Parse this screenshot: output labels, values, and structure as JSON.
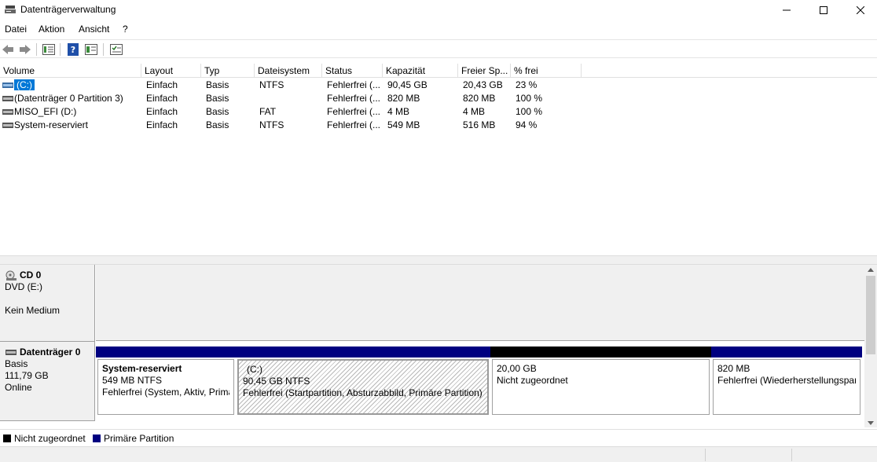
{
  "window": {
    "title": "Datenträgerverwaltung"
  },
  "menu": [
    {
      "id": "file",
      "label": "Datei"
    },
    {
      "id": "action",
      "label": "Aktion"
    },
    {
      "id": "view",
      "label": "Ansicht"
    },
    {
      "id": "help",
      "label": "?"
    }
  ],
  "toolbar": {
    "icons": [
      "back-arrow-icon",
      "forward-arrow-icon",
      "properties-icon",
      "help-icon",
      "console-tree-icon",
      "rescan-icon"
    ]
  },
  "volume_list": {
    "columns": [
      "Volume",
      "Layout",
      "Typ",
      "Dateisystem",
      "Status",
      "Kapazität",
      "Freier Sp...",
      "% frei"
    ],
    "rows": [
      {
        "volume": "(C:)",
        "layout": "Einfach",
        "type": "Basis",
        "fs": "NTFS",
        "status": "Fehlerfrei (...",
        "capacity": "90,45 GB",
        "free": "20,43 GB",
        "pct": "23 %",
        "selected": true
      },
      {
        "volume": "(Datenträger 0 Partition 3)",
        "layout": "Einfach",
        "type": "Basis",
        "fs": "",
        "status": "Fehlerfrei (...",
        "capacity": "820 MB",
        "free": "820 MB",
        "pct": "100 %",
        "selected": false
      },
      {
        "volume": "MISO_EFI (D:)",
        "layout": "Einfach",
        "type": "Basis",
        "fs": "FAT",
        "status": "Fehlerfrei (...",
        "capacity": "4 MB",
        "free": "4 MB",
        "pct": "100 %",
        "selected": false
      },
      {
        "volume": "System-reserviert",
        "layout": "Einfach",
        "type": "Basis",
        "fs": "NTFS",
        "status": "Fehlerfrei (...",
        "capacity": "549 MB",
        "free": "516 MB",
        "pct": "94 %",
        "selected": false
      }
    ]
  },
  "disks": {
    "cd0": {
      "name": "CD 0",
      "line1": "DVD (E:)",
      "line2": "Kein Medium"
    },
    "disk0": {
      "name": "Datenträger 0",
      "type": "Basis",
      "size": "111,79 GB",
      "state": "Online",
      "partitions": [
        {
          "title": "System-reserviert",
          "size": "549 MB NTFS",
          "status": "Fehlerfrei (System, Aktiv, Primä",
          "kind": "primary"
        },
        {
          "title": "(C:)",
          "size": "90,45 GB NTFS",
          "status": "Fehlerfrei (Startpartition, Absturzabbild, Primäre Partition)",
          "kind": "primary"
        },
        {
          "title": "",
          "size": "20,00 GB",
          "status": "Nicht zugeordnet",
          "kind": "unallocated"
        },
        {
          "title": "",
          "size": "820 MB",
          "status": "Fehlerfrei (Wiederherstellungspart",
          "kind": "primary"
        }
      ]
    }
  },
  "legend": [
    {
      "label": "Nicht zugeordnet",
      "color": "#000000"
    },
    {
      "label": "Primäre Partition",
      "color": "#000080"
    }
  ],
  "colors": {
    "primary": "#000080",
    "unallocated": "#000000",
    "selection": "#0078d7"
  }
}
